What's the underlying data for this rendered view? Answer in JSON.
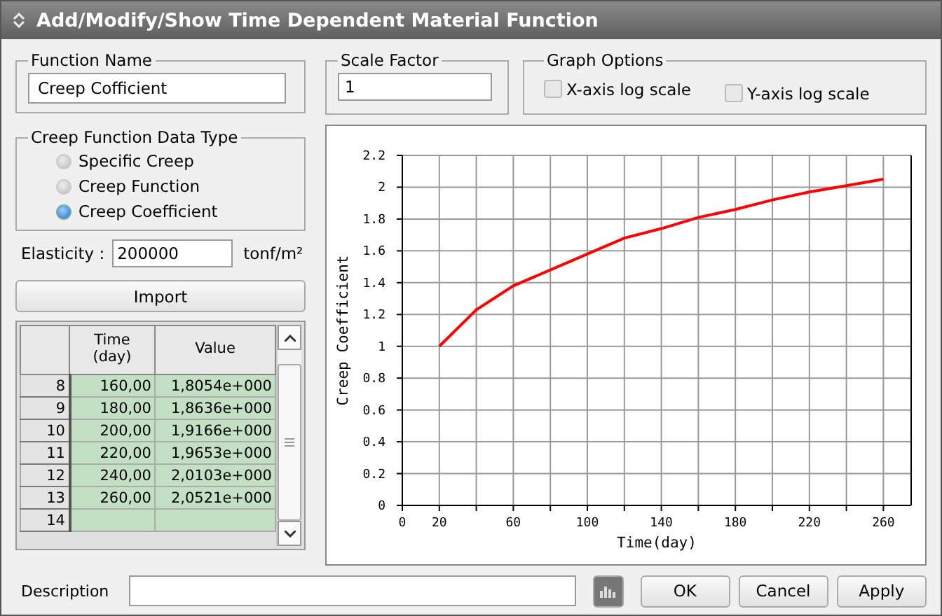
{
  "window": {
    "title": "Add/Modify/Show Time Dependent Material Function"
  },
  "function_name": {
    "label": "Function Name",
    "value": "Creep Cofficient"
  },
  "data_type": {
    "label": "Creep Function Data Type",
    "options": [
      {
        "label": "Specific Creep",
        "selected": false
      },
      {
        "label": "Creep Function",
        "selected": false
      },
      {
        "label": "Creep Coefficient",
        "selected": true
      }
    ]
  },
  "elasticity": {
    "label": "Elasticity :",
    "value": "200000",
    "unit": "tonf/m²"
  },
  "import_button": "Import",
  "table": {
    "columns": [
      "Time\n(day)",
      "Value"
    ],
    "rows": [
      {
        "index": "8",
        "time": "160,00",
        "value": "1,8054e+000"
      },
      {
        "index": "9",
        "time": "180,00",
        "value": "1,8636e+000"
      },
      {
        "index": "10",
        "time": "200,00",
        "value": "1,9166e+000"
      },
      {
        "index": "11",
        "time": "220,00",
        "value": "1,9653e+000"
      },
      {
        "index": "12",
        "time": "240,00",
        "value": "2,0103e+000"
      },
      {
        "index": "13",
        "time": "260,00",
        "value": "2,0521e+000"
      },
      {
        "index": "14"
      }
    ]
  },
  "scale_factor": {
    "label": "Scale Factor",
    "value": "1"
  },
  "graph_options": {
    "label": "Graph Options",
    "options": [
      {
        "label": "X-axis log scale",
        "checked": false
      },
      {
        "label": "Y-axis log scale",
        "checked": false
      }
    ]
  },
  "chart": {
    "chart_data": {
      "type": "line",
      "xlabel": "Time(day)",
      "ylabel": "Creep Coefficient",
      "x": [
        20,
        40,
        60,
        80,
        100,
        120,
        140,
        160,
        180,
        200,
        220,
        240,
        260
      ],
      "series": [
        {
          "color": "#ff0000",
          "values": [
            1.0,
            1.23,
            1.38,
            1.48,
            1.58,
            1.68,
            1.74,
            1.81,
            1.86,
            1.92,
            1.97,
            2.01,
            2.05
          ]
        }
      ],
      "grid": true,
      "xlim": [
        0,
        275
      ],
      "ylim": [
        0,
        2.2
      ],
      "xticks": [
        0,
        20,
        60,
        100,
        140,
        180,
        220,
        260
      ],
      "yticks": [
        {
          "value": 0,
          "label": "0"
        },
        {
          "value": 0.2,
          "label": "0.2"
        },
        {
          "value": 0.4,
          "label": "0.4"
        },
        {
          "value": 0.6,
          "label": "0.6"
        },
        {
          "value": 0.8,
          "label": "0.8"
        },
        {
          "value": 1,
          "label": "1"
        },
        {
          "value": 1.2,
          "label": "1.2"
        },
        {
          "value": 1.4,
          "label": "1.4"
        },
        {
          "value": 1.6,
          "label": "1.6"
        },
        {
          "value": 1.8,
          "label": "1.8"
        },
        {
          "value": 2,
          "label": "2"
        },
        {
          "value": 2.2,
          "label": "2.2"
        }
      ]
    }
  },
  "description": {
    "label": "Description"
  },
  "buttons": [
    {
      "kind": "icon"
    },
    {
      "kind": "text",
      "label": "OK"
    },
    {
      "kind": "text",
      "label": "Cancel"
    },
    {
      "kind": "text",
      "label": "Apply"
    }
  ]
}
